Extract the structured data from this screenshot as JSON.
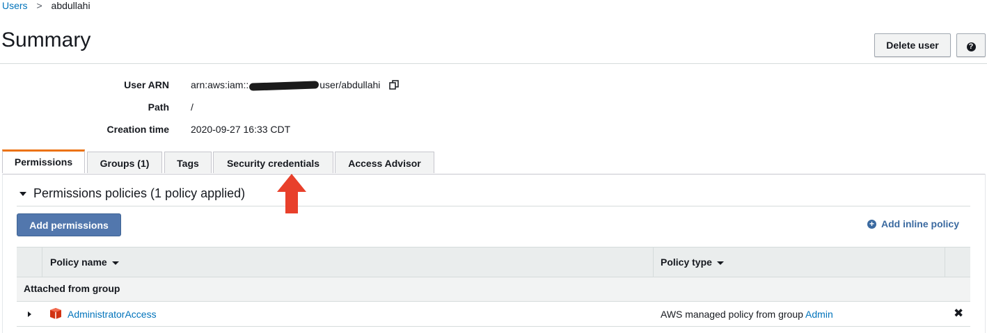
{
  "breadcrumb": {
    "parent": "Users",
    "separator": ">",
    "current": "abdullahi"
  },
  "page": {
    "title": "Summary"
  },
  "actions": {
    "delete_user": "Delete user",
    "help_symbol": "?"
  },
  "summary": {
    "user_arn_label": "User ARN",
    "user_arn_prefix": "arn:aws:iam::",
    "user_arn_suffix": "user/abdullahi",
    "path_label": "Path",
    "path_value": "/",
    "creation_label": "Creation time",
    "creation_value": "2020-09-27 16:33 CDT"
  },
  "tabs": [
    {
      "label": "Permissions",
      "active": true
    },
    {
      "label": "Groups (1)",
      "active": false
    },
    {
      "label": "Tags",
      "active": false
    },
    {
      "label": "Security credentials",
      "active": false
    },
    {
      "label": "Access Advisor",
      "active": false
    }
  ],
  "permissions": {
    "section_title": "Permissions policies (1 policy applied)",
    "add_permissions": "Add permissions",
    "add_inline_policy": "Add inline policy",
    "table": {
      "columns": [
        "Policy name",
        "Policy type"
      ],
      "group_header": "Attached from group",
      "rows": [
        {
          "name": "AdministratorAccess",
          "type_text": "AWS managed policy from group",
          "group_link": "Admin"
        }
      ]
    }
  },
  "colors": {
    "accent_tab": "#ec7211",
    "primary_button": "#5277ad",
    "link": "#0073bb",
    "annotation_arrow": "#e8402b",
    "policy_icon": "#d13212"
  },
  "icons": {
    "copy": "copy-icon",
    "help": "help-icon",
    "caret": "caret-down-icon",
    "add": "plus-circle-icon",
    "policy": "aws-policy-box-icon",
    "remove": "close-icon",
    "annotation": "arrow-up-icon"
  }
}
